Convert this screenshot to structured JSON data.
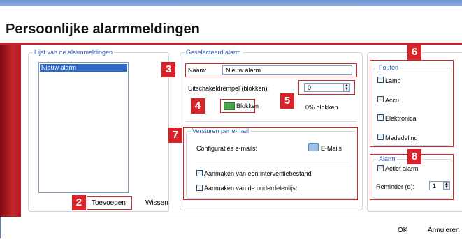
{
  "title": "Persoonlijke alarmmeldingen",
  "list_group": {
    "legend": "Lijst van de alarmmeldingen",
    "items": [
      "Nieuw alarm"
    ],
    "add_label": "Toevoegen",
    "delete_label": "Wissen"
  },
  "selected_group": {
    "legend": "Geselecteerd alarm",
    "name_label": "Naam:",
    "name_value": "Nieuw alarm",
    "threshold_label": "Uitschakeldrempel (blokken):",
    "threshold_value": "0",
    "blocks_label": "Blokken",
    "percent_label": "0% blokken"
  },
  "email_group": {
    "legend": "Versturen per e-mail",
    "config_label": "Configuraties e-mails:",
    "emails_button": "E-Mails",
    "create_intervention": "Aanmaken van een interventiebestand",
    "create_parts": "Aanmaken van de onderdelenlijst"
  },
  "faults_group": {
    "legend": "Fouten",
    "items": [
      "Lamp",
      "Accu",
      "Elektronica",
      "Mededeling"
    ]
  },
  "alarm_group": {
    "legend": "Alarm",
    "active_label": "Actief alarm",
    "reminder_label": "Reminder (d):",
    "reminder_value": "1"
  },
  "footer": {
    "ok": "OK",
    "cancel": "Annuleren"
  },
  "callouts": [
    "2",
    "3",
    "4",
    "5",
    "6",
    "7",
    "8"
  ],
  "colors": {
    "accent_red": "#d8232a",
    "title_blue": "#2f5fae",
    "selection": "#316ac5"
  }
}
